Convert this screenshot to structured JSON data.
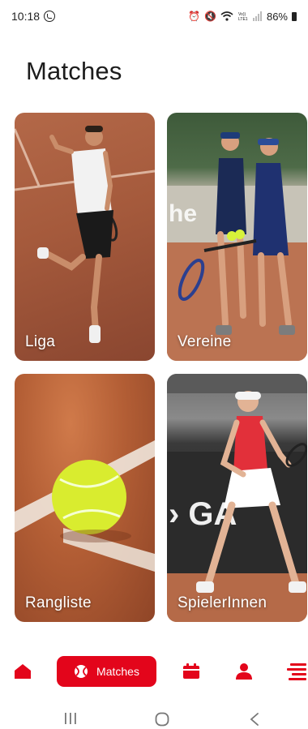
{
  "status_bar": {
    "time": "10:18",
    "battery": "86%",
    "icons": [
      "whatsapp-icon",
      "alarm-icon",
      "mute-icon",
      "wifi-icon",
      "volte-icon",
      "signal-icon",
      "battery-icon"
    ],
    "volte_text": "Vo))\nLTE1"
  },
  "page": {
    "title": "Matches"
  },
  "cards": [
    {
      "id": "liga",
      "label": "Liga"
    },
    {
      "id": "vereine",
      "label": "Vereine"
    },
    {
      "id": "rangliste",
      "label": "Rangliste"
    },
    {
      "id": "spieler",
      "label": "SpielerInnen"
    }
  ],
  "bottom_nav": {
    "items": [
      {
        "id": "home",
        "icon": "home-icon"
      },
      {
        "id": "matches",
        "icon": "tennis-ball-icon",
        "label": "Matches",
        "active": true
      },
      {
        "id": "calendar",
        "icon": "calendar-icon"
      },
      {
        "id": "profile",
        "icon": "person-icon"
      },
      {
        "id": "menu",
        "icon": "menu-icon"
      }
    ]
  },
  "colors": {
    "accent": "#e3051b",
    "title": "#1c1c1c",
    "card_label": "#ffffff"
  }
}
